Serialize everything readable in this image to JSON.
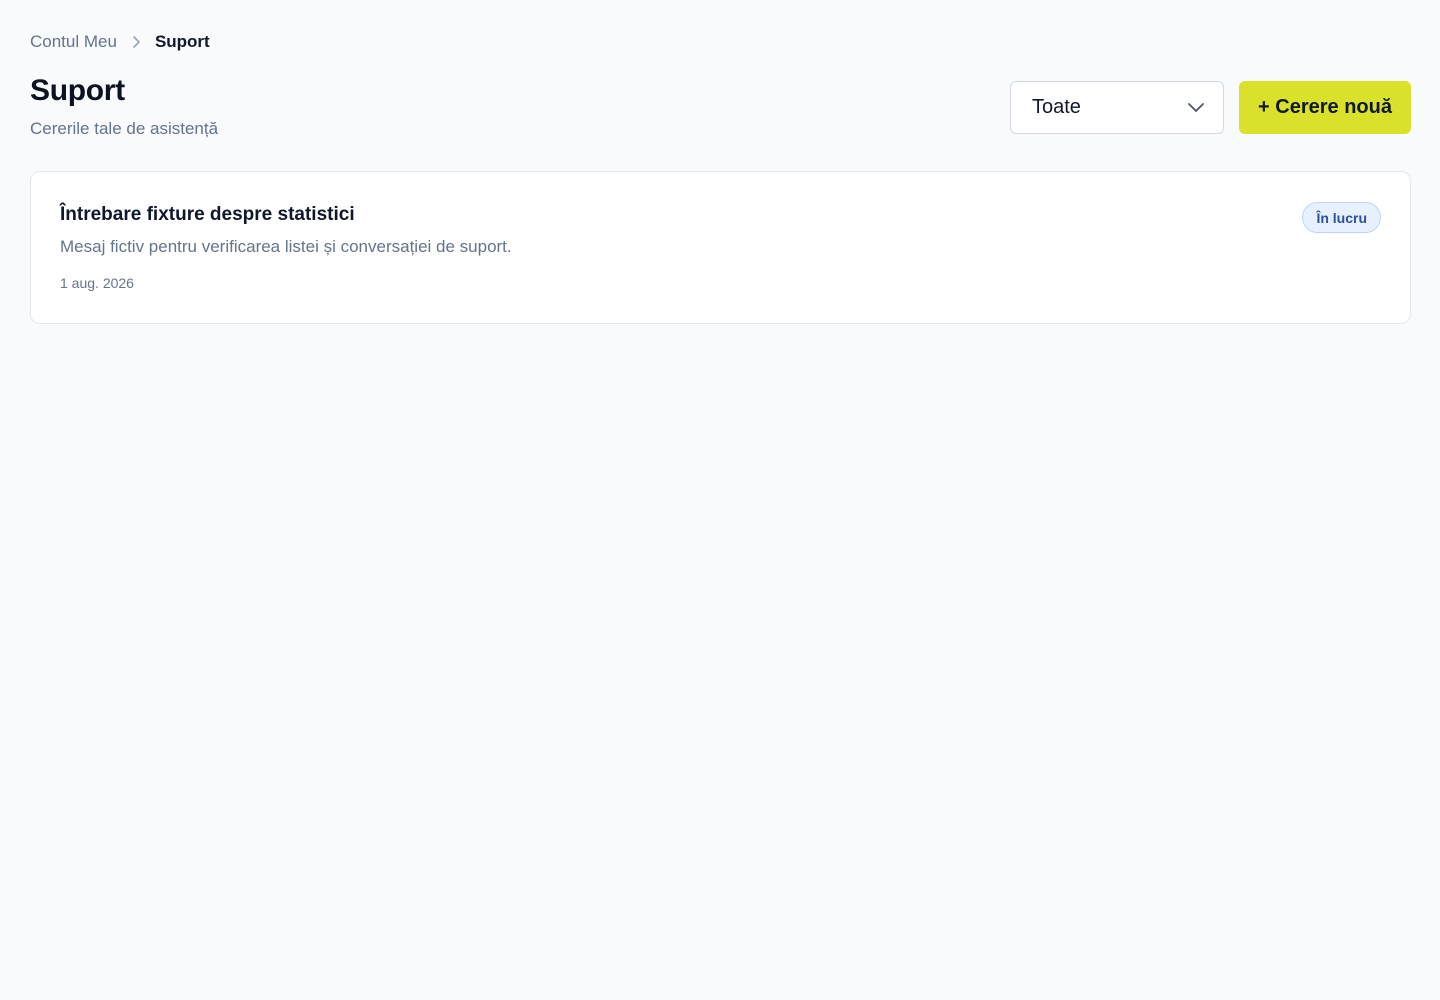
{
  "breadcrumb": {
    "parent_label": "Contul Meu",
    "current_label": "Suport"
  },
  "page": {
    "title": "Suport",
    "subtitle": "Cererile tale de asistență"
  },
  "filter": {
    "selected": "Toate",
    "icon": "chevron-down-icon"
  },
  "actions": {
    "new_request_label": "+ Cerere nouă",
    "accent_color": "#d9e12b"
  },
  "tickets": [
    {
      "title": "Întrebare fixture despre statistici",
      "preview": "Mesaj fictiv pentru verificarea listei și conversației de suport.",
      "date": "1 aug. 2026",
      "status": "În lucru",
      "status_color": "#2c4fa3"
    }
  ]
}
